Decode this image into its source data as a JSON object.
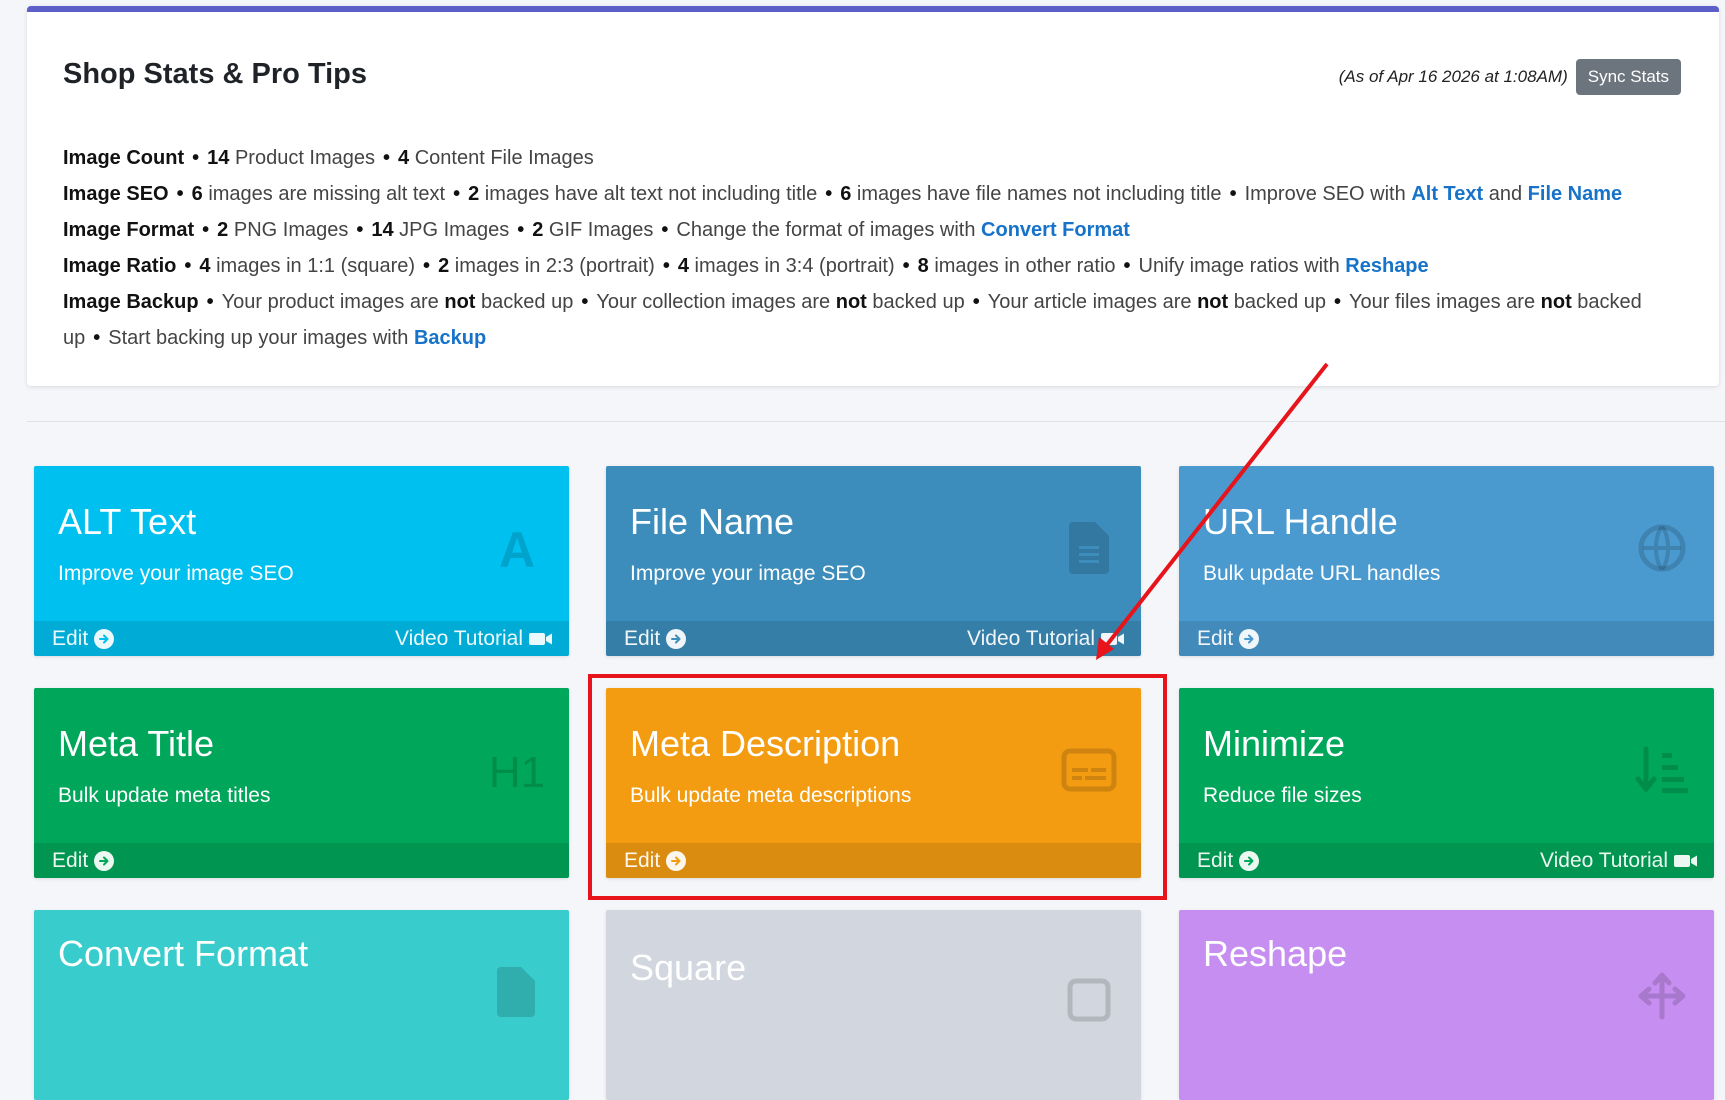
{
  "stats": {
    "title": "Shop Stats & Pro Tips",
    "as_of": "(As of Apr 16 2026 at 1:08AM)",
    "sync_label": "Sync Stats",
    "image_count": {
      "label": "Image Count",
      "product_num": "14",
      "product_text": "Product Images",
      "content_num": "4",
      "content_text": "Content File Images"
    },
    "image_seo": {
      "label": "Image SEO",
      "missing_alt_num": "6",
      "missing_alt_text": "images are missing alt text",
      "alt_no_title_num": "2",
      "alt_no_title_text": "images have alt text not including title",
      "filename_no_title_num": "6",
      "filename_no_title_text": "images have file names not including title",
      "tip_prefix": "Improve SEO with",
      "link_alt": "Alt Text",
      "tip_and": "and",
      "link_filename": "File Name"
    },
    "image_format": {
      "label": "Image Format",
      "png_num": "2",
      "png_text": "PNG Images",
      "jpg_num": "14",
      "jpg_text": "JPG Images",
      "gif_num": "2",
      "gif_text": "GIF Images",
      "tip_prefix": "Change the format of images with",
      "link_convert": "Convert Format"
    },
    "image_ratio": {
      "label": "Image Ratio",
      "square_num": "4",
      "square_text": "images in 1:1 (square)",
      "r23_num": "2",
      "r23_text": "images in 2:3 (portrait)",
      "r34_num": "4",
      "r34_text": "images in 3:4 (portrait)",
      "other_num": "8",
      "other_text": "images in other ratio",
      "tip_prefix": "Unify image ratios with",
      "link_reshape": "Reshape"
    },
    "image_backup": {
      "label": "Image Backup",
      "product_pre": "Your product images are",
      "collection_pre": "Your collection images are",
      "article_pre": "Your article images are",
      "files_pre": "Your files images are",
      "not_word": "not",
      "backed_up": "backed up",
      "tip_prefix": "Start backing up your images with",
      "link_backup": "Backup"
    }
  },
  "tiles": [
    {
      "title": "ALT Text",
      "subtitle": "Improve your image SEO",
      "edit": "Edit",
      "video": "Video Tutorial",
      "color": "#00c0ef",
      "icon": "letter-a-icon"
    },
    {
      "title": "File Name",
      "subtitle": "Improve your image SEO",
      "edit": "Edit",
      "video": "Video Tutorial",
      "color": "#3c8dbc",
      "icon": "file-icon"
    },
    {
      "title": "URL Handle",
      "subtitle": "Bulk update URL handles",
      "edit": "Edit",
      "color": "#4a9ad0",
      "icon": "globe-icon"
    },
    {
      "title": "Meta Title",
      "subtitle": "Bulk update meta titles",
      "edit": "Edit",
      "color": "#00a65a",
      "icon": "h1-icon"
    },
    {
      "title": "Meta Description",
      "subtitle": "Bulk update meta descriptions",
      "edit": "Edit",
      "color": "#f39c12",
      "icon": "subtitles-icon"
    },
    {
      "title": "Minimize",
      "subtitle": "Reduce file sizes",
      "edit": "Edit",
      "video": "Video Tutorial",
      "color": "#00a65a",
      "icon": "sort-down-icon"
    },
    {
      "title": "Convert Format",
      "color": "#39cccc",
      "icon": "file-convert-icon"
    },
    {
      "title": "Square",
      "color": "#d2d6de",
      "icon": "square-icon"
    },
    {
      "title": "Reshape",
      "color": "#c68ef0",
      "icon": "arrows-icon"
    }
  ]
}
